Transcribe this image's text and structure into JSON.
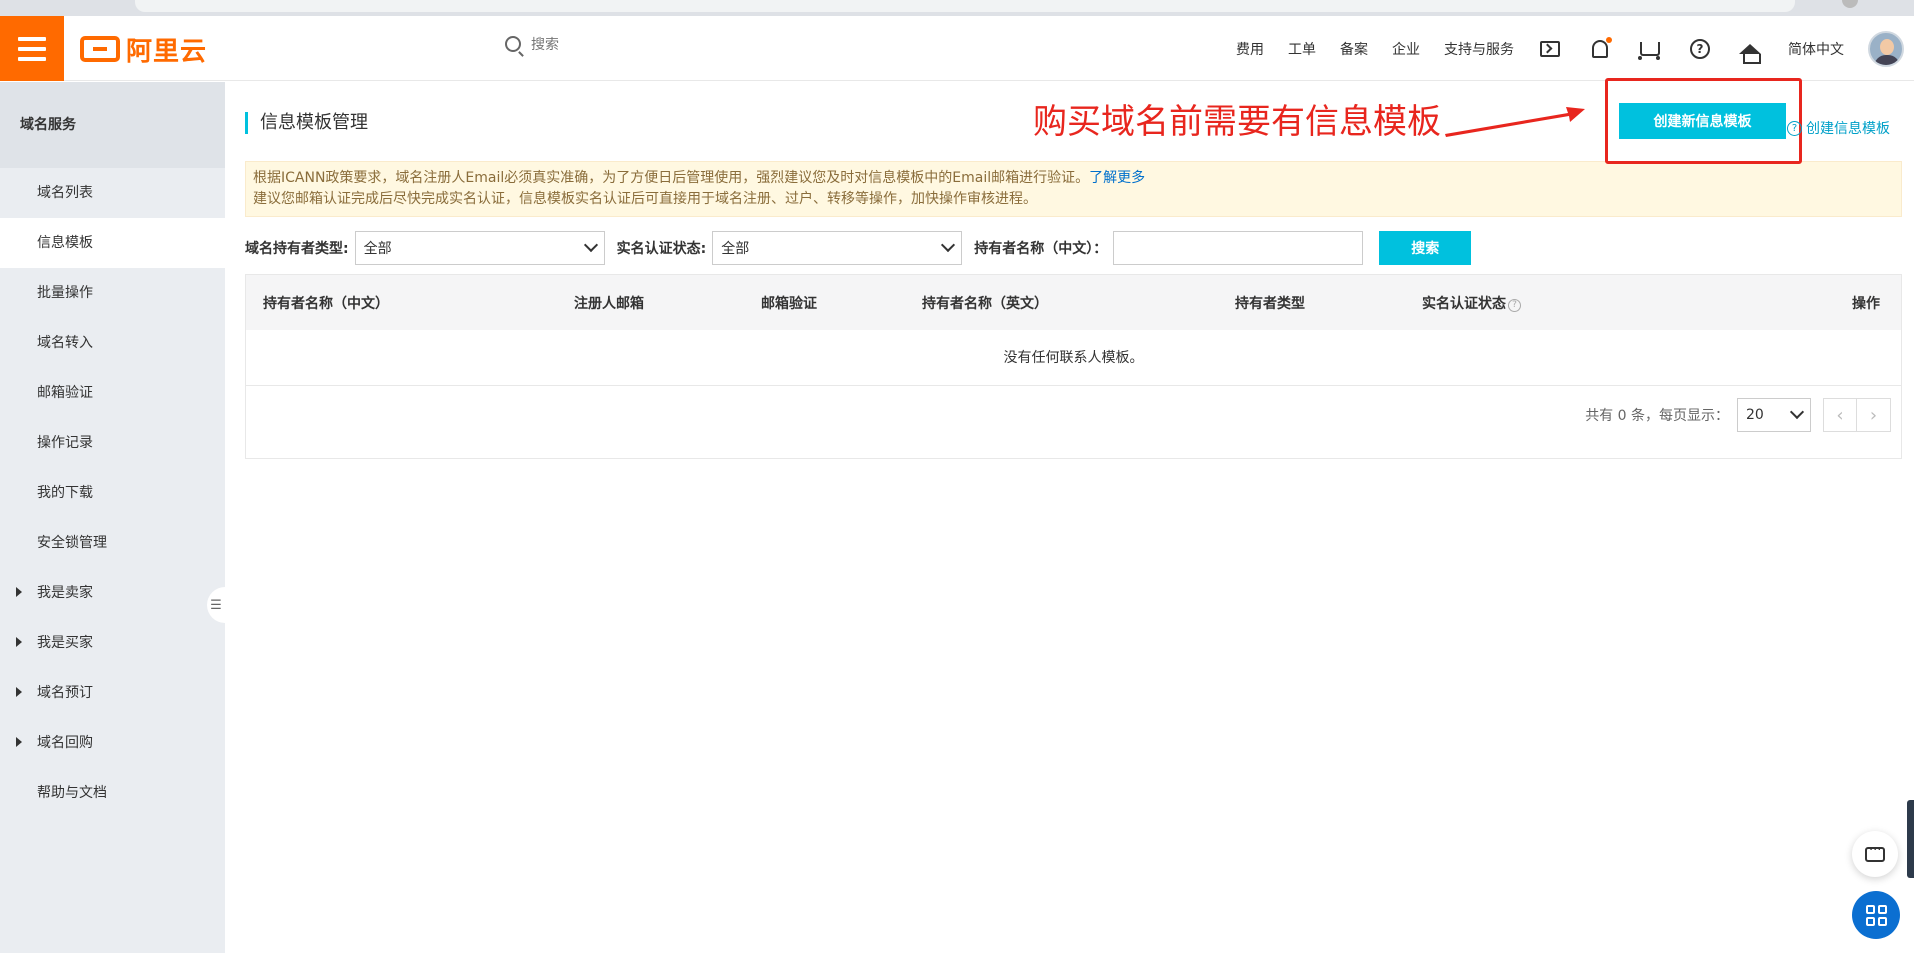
{
  "topbar": {
    "logo_text": "阿里云",
    "search_placeholder": "搜索",
    "nav": [
      "费用",
      "工单",
      "备案",
      "企业",
      "支持与服务"
    ],
    "language": "简体中文",
    "icons": [
      "terminal-icon",
      "bell-icon",
      "cart-icon",
      "help-icon",
      "home-icon"
    ]
  },
  "sidebar": {
    "title": "域名服务",
    "items": [
      {
        "label": "域名列表"
      },
      {
        "label": "信息模板",
        "active": true
      },
      {
        "label": "批量操作"
      },
      {
        "label": "域名转入"
      },
      {
        "label": "邮箱验证"
      },
      {
        "label": "操作记录"
      },
      {
        "label": "我的下载"
      },
      {
        "label": "安全锁管理"
      },
      {
        "label": "我是卖家",
        "group": true
      },
      {
        "label": "我是买家",
        "group": true
      },
      {
        "label": "域名预订",
        "group": true
      },
      {
        "label": "域名回购",
        "group": true
      },
      {
        "label": "帮助与文档"
      }
    ]
  },
  "page": {
    "title": "信息模板管理",
    "create_button": "创建新信息模板",
    "help_link": "创建信息模板",
    "annotation": "购买域名前需要有信息模板"
  },
  "notice": {
    "line1": "根据ICANN政策要求，域名注册人Email必须真实准确，为了方便日后管理使用，强烈建议您及时对信息模板中的Email邮箱进行验证。",
    "link": "了解更多",
    "line2": "建议您邮箱认证完成后尽快完成实名认证，信息模板实名认证后可直接用于域名注册、过户、转移等操作，加快操作审核进程。"
  },
  "filters": {
    "holder_type_label": "域名持有者类型:",
    "holder_type_value": "全部",
    "auth_status_label": "实名认证状态:",
    "auth_status_value": "全部",
    "holder_name_label": "持有者名称（中文）：",
    "holder_name_value": "",
    "search_button": "搜索"
  },
  "table": {
    "columns": [
      "持有者名称（中文）",
      "注册人邮箱",
      "邮箱验证",
      "持有者名称（英文）",
      "持有者类型",
      "实名认证状态",
      "操作"
    ],
    "empty_text": "没有任何联系人模板。"
  },
  "pagination": {
    "summary": "共有 0 条，每页显示：",
    "page_size": "20",
    "prev": "‹",
    "next": "›"
  },
  "colors": {
    "brand": "#ff6a00",
    "accent": "#00c1de",
    "annotation": "#e8261e"
  }
}
